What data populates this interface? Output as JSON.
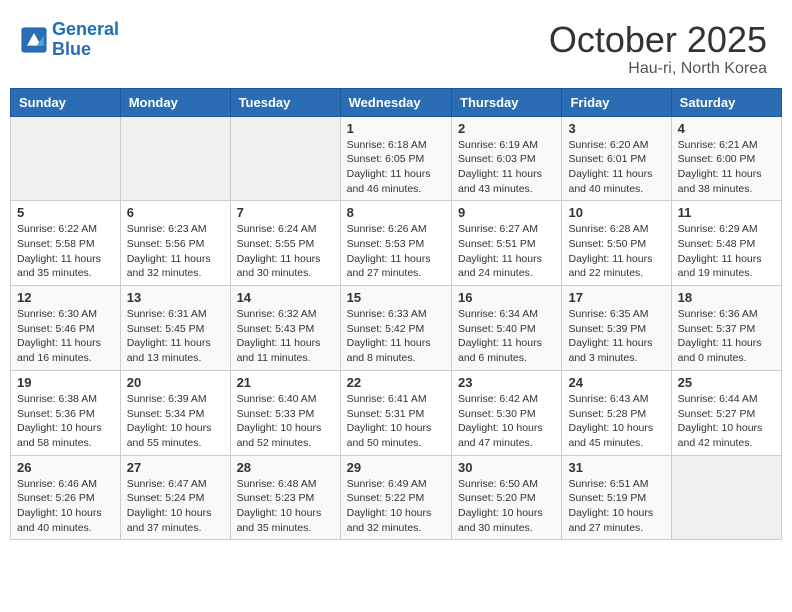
{
  "logo": {
    "line1": "General",
    "line2": "Blue"
  },
  "title": "October 2025",
  "location": "Hau-ri, North Korea",
  "days_of_week": [
    "Sunday",
    "Monday",
    "Tuesday",
    "Wednesday",
    "Thursday",
    "Friday",
    "Saturday"
  ],
  "weeks": [
    [
      {
        "day": "",
        "info": ""
      },
      {
        "day": "",
        "info": ""
      },
      {
        "day": "",
        "info": ""
      },
      {
        "day": "1",
        "info": "Sunrise: 6:18 AM\nSunset: 6:05 PM\nDaylight: 11 hours and 46 minutes."
      },
      {
        "day": "2",
        "info": "Sunrise: 6:19 AM\nSunset: 6:03 PM\nDaylight: 11 hours and 43 minutes."
      },
      {
        "day": "3",
        "info": "Sunrise: 6:20 AM\nSunset: 6:01 PM\nDaylight: 11 hours and 40 minutes."
      },
      {
        "day": "4",
        "info": "Sunrise: 6:21 AM\nSunset: 6:00 PM\nDaylight: 11 hours and 38 minutes."
      }
    ],
    [
      {
        "day": "5",
        "info": "Sunrise: 6:22 AM\nSunset: 5:58 PM\nDaylight: 11 hours and 35 minutes."
      },
      {
        "day": "6",
        "info": "Sunrise: 6:23 AM\nSunset: 5:56 PM\nDaylight: 11 hours and 32 minutes."
      },
      {
        "day": "7",
        "info": "Sunrise: 6:24 AM\nSunset: 5:55 PM\nDaylight: 11 hours and 30 minutes."
      },
      {
        "day": "8",
        "info": "Sunrise: 6:26 AM\nSunset: 5:53 PM\nDaylight: 11 hours and 27 minutes."
      },
      {
        "day": "9",
        "info": "Sunrise: 6:27 AM\nSunset: 5:51 PM\nDaylight: 11 hours and 24 minutes."
      },
      {
        "day": "10",
        "info": "Sunrise: 6:28 AM\nSunset: 5:50 PM\nDaylight: 11 hours and 22 minutes."
      },
      {
        "day": "11",
        "info": "Sunrise: 6:29 AM\nSunset: 5:48 PM\nDaylight: 11 hours and 19 minutes."
      }
    ],
    [
      {
        "day": "12",
        "info": "Sunrise: 6:30 AM\nSunset: 5:46 PM\nDaylight: 11 hours and 16 minutes."
      },
      {
        "day": "13",
        "info": "Sunrise: 6:31 AM\nSunset: 5:45 PM\nDaylight: 11 hours and 13 minutes."
      },
      {
        "day": "14",
        "info": "Sunrise: 6:32 AM\nSunset: 5:43 PM\nDaylight: 11 hours and 11 minutes."
      },
      {
        "day": "15",
        "info": "Sunrise: 6:33 AM\nSunset: 5:42 PM\nDaylight: 11 hours and 8 minutes."
      },
      {
        "day": "16",
        "info": "Sunrise: 6:34 AM\nSunset: 5:40 PM\nDaylight: 11 hours and 6 minutes."
      },
      {
        "day": "17",
        "info": "Sunrise: 6:35 AM\nSunset: 5:39 PM\nDaylight: 11 hours and 3 minutes."
      },
      {
        "day": "18",
        "info": "Sunrise: 6:36 AM\nSunset: 5:37 PM\nDaylight: 11 hours and 0 minutes."
      }
    ],
    [
      {
        "day": "19",
        "info": "Sunrise: 6:38 AM\nSunset: 5:36 PM\nDaylight: 10 hours and 58 minutes."
      },
      {
        "day": "20",
        "info": "Sunrise: 6:39 AM\nSunset: 5:34 PM\nDaylight: 10 hours and 55 minutes."
      },
      {
        "day": "21",
        "info": "Sunrise: 6:40 AM\nSunset: 5:33 PM\nDaylight: 10 hours and 52 minutes."
      },
      {
        "day": "22",
        "info": "Sunrise: 6:41 AM\nSunset: 5:31 PM\nDaylight: 10 hours and 50 minutes."
      },
      {
        "day": "23",
        "info": "Sunrise: 6:42 AM\nSunset: 5:30 PM\nDaylight: 10 hours and 47 minutes."
      },
      {
        "day": "24",
        "info": "Sunrise: 6:43 AM\nSunset: 5:28 PM\nDaylight: 10 hours and 45 minutes."
      },
      {
        "day": "25",
        "info": "Sunrise: 6:44 AM\nSunset: 5:27 PM\nDaylight: 10 hours and 42 minutes."
      }
    ],
    [
      {
        "day": "26",
        "info": "Sunrise: 6:46 AM\nSunset: 5:26 PM\nDaylight: 10 hours and 40 minutes."
      },
      {
        "day": "27",
        "info": "Sunrise: 6:47 AM\nSunset: 5:24 PM\nDaylight: 10 hours and 37 minutes."
      },
      {
        "day": "28",
        "info": "Sunrise: 6:48 AM\nSunset: 5:23 PM\nDaylight: 10 hours and 35 minutes."
      },
      {
        "day": "29",
        "info": "Sunrise: 6:49 AM\nSunset: 5:22 PM\nDaylight: 10 hours and 32 minutes."
      },
      {
        "day": "30",
        "info": "Sunrise: 6:50 AM\nSunset: 5:20 PM\nDaylight: 10 hours and 30 minutes."
      },
      {
        "day": "31",
        "info": "Sunrise: 6:51 AM\nSunset: 5:19 PM\nDaylight: 10 hours and 27 minutes."
      },
      {
        "day": "",
        "info": ""
      }
    ]
  ]
}
